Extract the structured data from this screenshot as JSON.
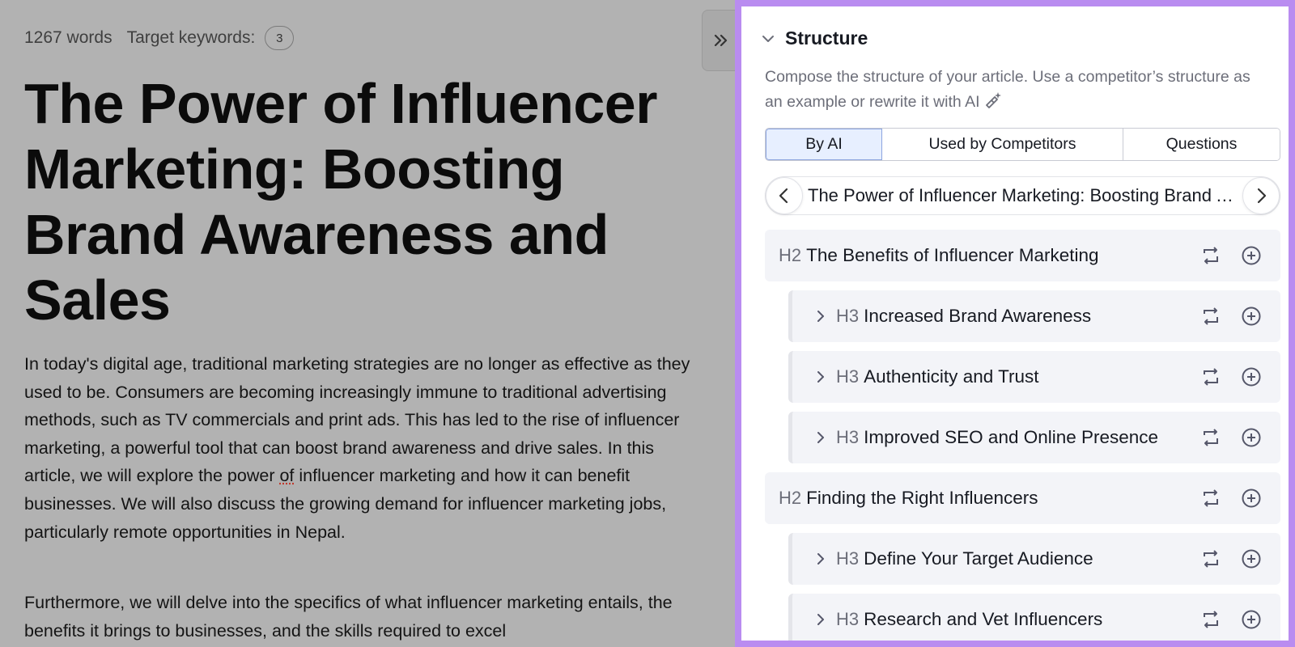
{
  "editor": {
    "word_count": "1267 words",
    "target_keywords_label": "Target keywords:",
    "target_keywords_count": "3",
    "title": "The Power of Influencer Marketing: Boosting Brand Awareness and Sales",
    "paragraph1_part1": "In today's digital age, traditional marketing strategies are no longer as effective as they used to be. Consumers are becoming increasingly immune to traditional advertising methods, such as TV commercials and print ads. This has led to the rise of influencer marketing, a powerful tool that can boost brand awareness and drive sales. In this article, we will explore the power ",
    "paragraph1_typo": "of",
    "paragraph1_part2": " influencer marketing and how it can benefit businesses. We will also discuss the growing demand for influencer marketing jobs, particularly remote opportunities in Nepal.",
    "paragraph2": "Furthermore, we will delve into the specifics of what influencer marketing entails, the benefits it brings to businesses, and the skills required to excel"
  },
  "panel": {
    "section_title": "Structure",
    "description": "Compose the structure of your article. Use a competitor’s structure as an example or rewrite it with AI",
    "tabs": [
      {
        "label": "By AI"
      },
      {
        "label": "Used by Competitors"
      },
      {
        "label": "Questions"
      }
    ],
    "carousel_text": "The Power of Influencer Marketing: Boosting Brand Awareness and Sales",
    "outline": [
      {
        "level": "H2",
        "text": "The Benefits of Influencer Marketing"
      },
      {
        "level": "H3",
        "text": "Increased Brand Awareness"
      },
      {
        "level": "H3",
        "text": "Authenticity and Trust"
      },
      {
        "level": "H3",
        "text": "Improved SEO and Online Presence"
      },
      {
        "level": "H2",
        "text": "Finding the Right Influencers"
      },
      {
        "level": "H3",
        "text": "Define Your Target Audience"
      },
      {
        "level": "H3",
        "text": "Research and Vet Influencers"
      }
    ]
  },
  "colors": {
    "panel_border": "#b98cf0",
    "active_tab_bg": "#e7efff",
    "row_bg": "#f3f4f8"
  },
  "icons": [
    "chevron-down-icon",
    "double-chevron-right-icon",
    "ai-magic-icon",
    "chevron-left-icon",
    "chevron-right-icon",
    "replace-icon",
    "add-circle-icon"
  ]
}
